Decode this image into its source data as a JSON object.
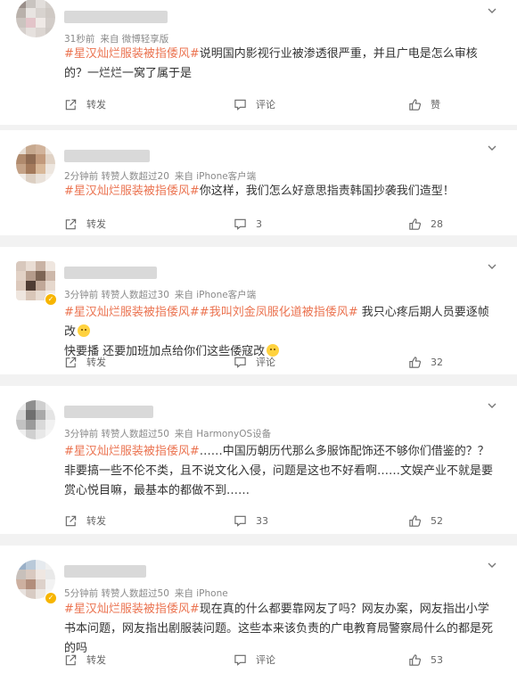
{
  "comments": [
    {
      "meta_time": "31秒前",
      "meta_source": "来自 微博轻享版",
      "hashtags": [
        "#星汉灿烂服装被指倭风#"
      ],
      "body": "说明国内影视行业被渗透很严重，并且广电是怎么审核的？一烂烂一窝了属于是",
      "forward_label": "转发",
      "comment_label": "评论",
      "like_label": "赞"
    },
    {
      "meta_time": "2分钟前",
      "meta_reposts": "转赞人数超过20",
      "meta_source": "来自 iPhone客户端",
      "hashtags": [
        "#星汉灿烂服装被指倭风#"
      ],
      "body": "你这样，我们怎么好意思指责韩国抄袭我们造型！",
      "forward_label": "转发",
      "comment_label": "3",
      "like_label": "28"
    },
    {
      "meta_time": "3分钟前",
      "meta_reposts": "转赞人数超过30",
      "meta_source": "来自 iPhone客户端",
      "hashtags": [
        "#星汉灿烂服装被指倭风#",
        "#我叫刘金凤服化道被指倭风#"
      ],
      "body": "我只心疼后期人员要逐帧改",
      "body2": "快要播 还要加班加点给你们这些倭寇改",
      "forward_label": "转发",
      "comment_label": "评论",
      "like_label": "32"
    },
    {
      "meta_time": "3分钟前",
      "meta_reposts": "转赞人数超过50",
      "meta_source": "来自 HarmonyOS设备",
      "hashtags": [
        "#星汉灿烂服装被指倭风#"
      ],
      "body": "……中国历朝历代那么多服饰配饰还不够你们借鉴的？？非要搞一些不伦不类，且不说文化入侵，问题是这也不好看啊……文娱产业不就是要赏心悦目嘛，最基本的都做不到……",
      "forward_label": "转发",
      "comment_label": "33",
      "like_label": "52"
    },
    {
      "meta_time": "5分钟前",
      "meta_reposts": "转赞人数超过50",
      "meta_source": "来自 iPhone",
      "hashtags": [
        "#星汉灿烂服装被指倭风#"
      ],
      "body": "现在真的什么都要靠网友了吗？网友办案，网友指出小学书本问题，网友指出剧服装问题。这些本来该负责的广电教育局警察局什么的都是死的吗",
      "forward_label": "转发",
      "comment_label": "评论",
      "like_label": "53"
    }
  ],
  "colors": {
    "hashtag": "#eb7350",
    "meta": "#8a8a8a",
    "background": "#f2f2f2",
    "vip_badge": "#f7b500"
  },
  "icons": [
    "share-icon",
    "comment-icon",
    "like-icon",
    "chevron-down-icon"
  ]
}
